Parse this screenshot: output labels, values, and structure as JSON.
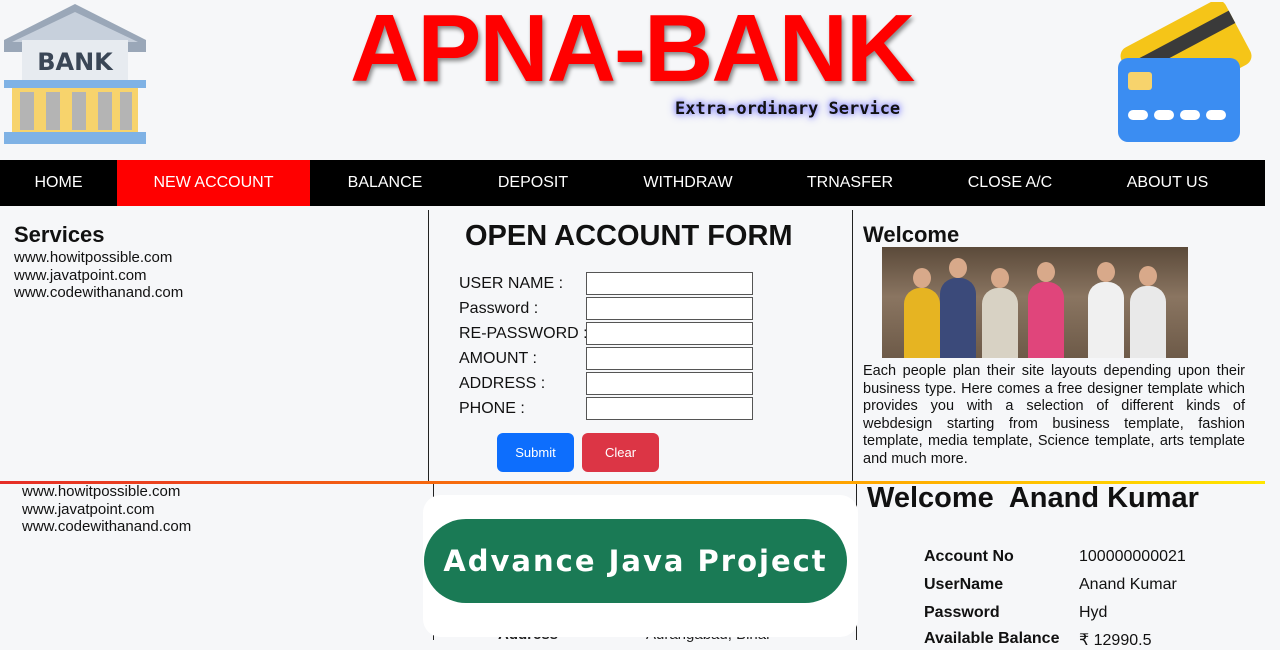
{
  "header": {
    "bank_logo_text": "BANK",
    "brand_title": "APNA-BANK",
    "tagline": "Extra-ordinary Service"
  },
  "nav": {
    "items": [
      {
        "label": "HOME"
      },
      {
        "label": "NEW ACCOUNT"
      },
      {
        "label": "BALANCE"
      },
      {
        "label": "DEPOSIT"
      },
      {
        "label": "WITHDRAW"
      },
      {
        "label": "TRNASFER"
      },
      {
        "label": "CLOSE A/C"
      },
      {
        "label": "ABOUT US"
      }
    ],
    "active": "NEW ACCOUNT",
    "active_color": "#ff0000"
  },
  "services": {
    "title": "Services",
    "links": [
      "www.howitpossible.com",
      "www.javatpoint.com",
      "www.codewithanand.com"
    ]
  },
  "form": {
    "title": "OPEN ACCOUNT FORM",
    "fields": [
      {
        "label": "USER NAME :",
        "value": ""
      },
      {
        "label": "Password :",
        "value": ""
      },
      {
        "label": "RE-PASSWORD :",
        "value": ""
      },
      {
        "label": "AMOUNT :",
        "value": ""
      },
      {
        "label": "ADDRESS :",
        "value": ""
      },
      {
        "label": "PHONE :",
        "value": ""
      }
    ],
    "submit_label": "Submit",
    "clear_label": "Clear"
  },
  "welcome": {
    "title": "Welcome",
    "text": "Each people plan their site layouts depending upon their business type. Here comes a free designer template which provides you with a selection of different kinds of webdesign starting from business template, fashion template, media template, Science template, arts template and much more."
  },
  "lower": {
    "links": [
      "www.howitpossible.com",
      "www.javatpoint.com",
      "www.codewithanand.com"
    ],
    "overlay_label": "Advance Java Project",
    "overlay_color": "#1a7a55",
    "clipped_address_label": "Address",
    "clipped_address_value": "Aurangabad, Bihar",
    "welcome_user": "Welcome  Anand Kumar",
    "account": [
      {
        "key": "Account No",
        "value": "100000000021"
      },
      {
        "key": "UserName",
        "value": "Anand Kumar"
      },
      {
        "key": "Password",
        "value": "Hyd"
      },
      {
        "key": "Available Balance",
        "value": "₹ 12990.5"
      }
    ]
  }
}
